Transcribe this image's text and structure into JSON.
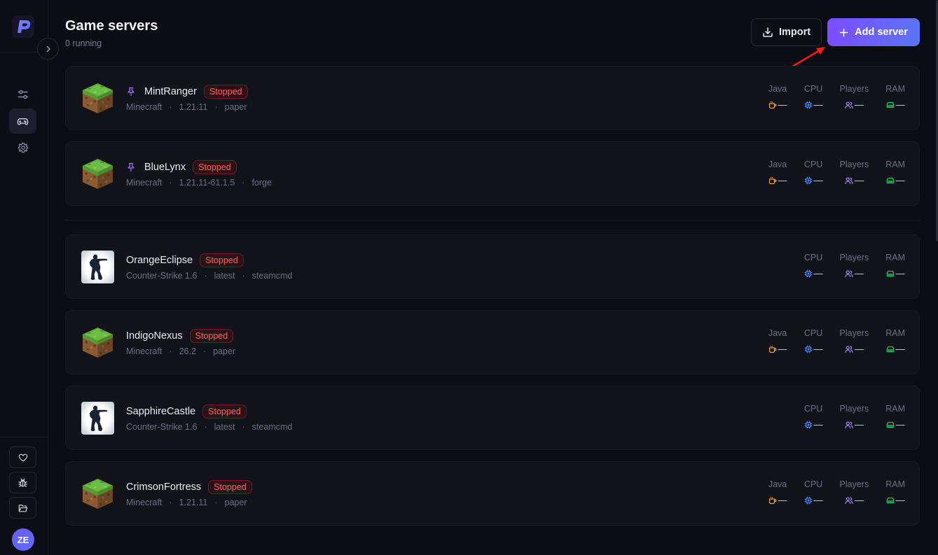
{
  "header": {
    "title": "Game servers",
    "subtitle": "0 running",
    "import_label": "Import",
    "add_label": "Add server"
  },
  "sidebar": {
    "nav": [
      "sliders-icon",
      "gamepad-icon",
      "gear-icon"
    ],
    "active": "gamepad-icon",
    "bottom": [
      "heart-icon",
      "bug-icon",
      "folder-icon"
    ],
    "avatar_initials": "ZE"
  },
  "colors": {
    "accent_start": "#7c4dff",
    "accent_end": "#5b74f5",
    "stopped": "#ff6161",
    "java": "#f5a524",
    "cpu": "#4a8dff",
    "players": "#a78bfa",
    "ram": "#22c55e"
  },
  "labels": {
    "java": "Java",
    "cpu": "CPU",
    "players": "Players",
    "ram": "RAM",
    "empty": "—"
  },
  "servers": [
    {
      "name": "MintRanger",
      "game": "Minecraft",
      "version": "1.21.11",
      "loader": "paper",
      "status": "Stopped",
      "pinned": true,
      "java": true
    },
    {
      "name": "BlueLynx",
      "game": "Minecraft",
      "version": "1.21.11-61.1.5",
      "loader": "forge",
      "status": "Stopped",
      "pinned": true,
      "java": true
    },
    {
      "name": "OrangeEclipse",
      "game": "Counter-Strike 1.6",
      "version": "latest",
      "loader": "steamcmd",
      "status": "Stopped",
      "pinned": false,
      "java": false
    },
    {
      "name": "IndigoNexus",
      "game": "Minecraft",
      "version": "26.2",
      "loader": "paper",
      "status": "Stopped",
      "pinned": false,
      "java": true
    },
    {
      "name": "SapphireCastle",
      "game": "Counter-Strike 1.6",
      "version": "latest",
      "loader": "steamcmd",
      "status": "Stopped",
      "pinned": false,
      "java": false
    },
    {
      "name": "CrimsonFortress",
      "game": "Minecraft",
      "version": "1.21.11",
      "loader": "paper",
      "status": "Stopped",
      "pinned": false,
      "java": true
    }
  ]
}
